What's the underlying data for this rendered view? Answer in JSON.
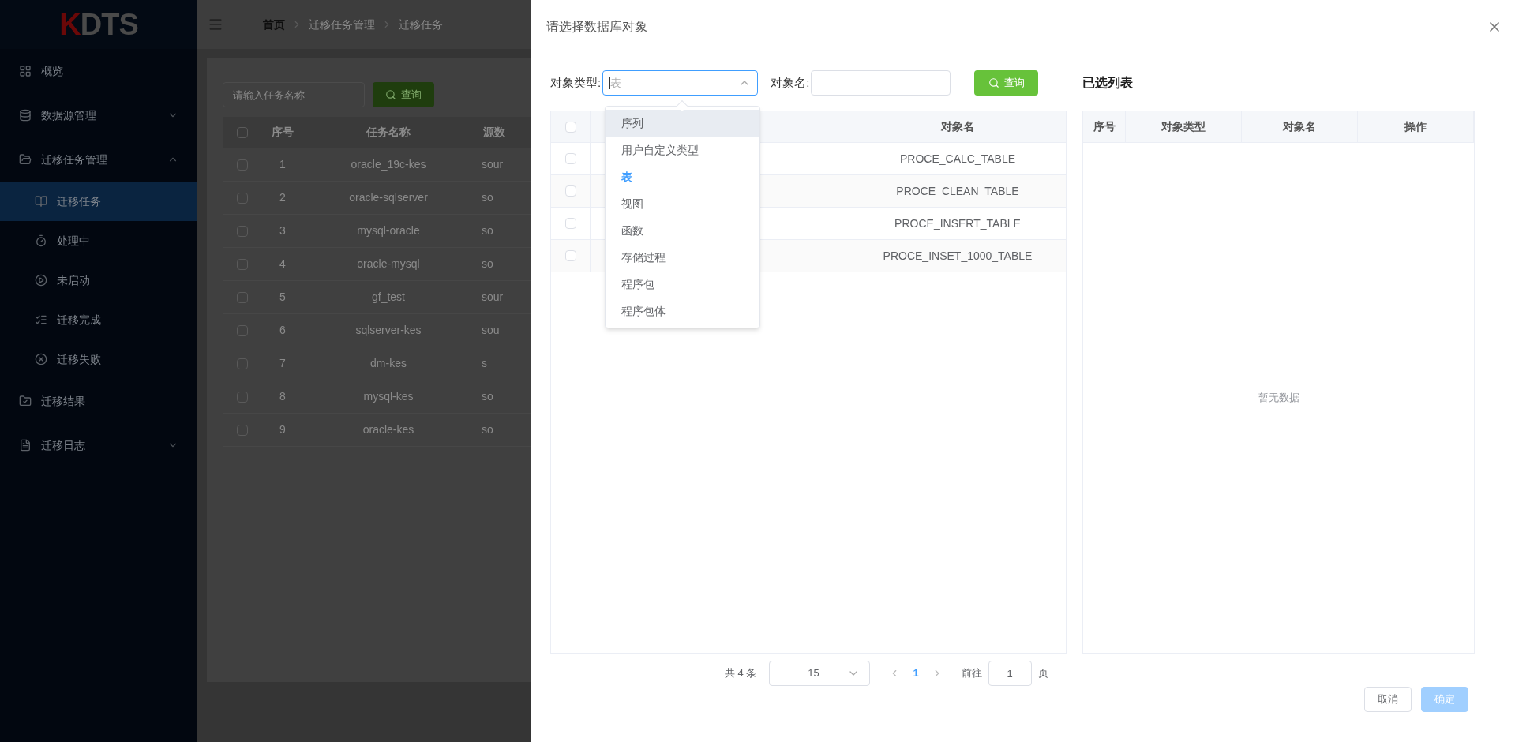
{
  "logo": {
    "text": "KDTS"
  },
  "sidebar": {
    "items": [
      {
        "label": "概览",
        "selected": false
      },
      {
        "label": "数据源管理",
        "selected": false,
        "expanded": false
      },
      {
        "label": "迁移任务管理",
        "selected": false,
        "expanded": true,
        "children": [
          {
            "label": "迁移任务",
            "selected": true
          },
          {
            "label": "处理中",
            "selected": false
          },
          {
            "label": "未启动",
            "selected": false
          },
          {
            "label": "迁移完成",
            "selected": false
          },
          {
            "label": "迁移失败",
            "selected": false
          }
        ]
      },
      {
        "label": "迁移结果",
        "selected": false
      },
      {
        "label": "迁移日志",
        "selected": false,
        "expanded": false
      }
    ]
  },
  "breadcrumb": [
    "首页",
    "迁移任务管理",
    "迁移任务"
  ],
  "task_search": {
    "placeholder": "请输入任务名称",
    "button": "查询"
  },
  "task_table": {
    "all_checked": false,
    "columns": [
      "序号",
      "任务名称",
      "源数"
    ],
    "rows": [
      {
        "checked": false,
        "cells": [
          "1",
          "oracle_19c-kes",
          "sour"
        ]
      },
      {
        "checked": false,
        "cells": [
          "2",
          "oracle-sqlserver",
          "so"
        ]
      },
      {
        "checked": false,
        "cells": [
          "3",
          "mysql-oracle",
          "so"
        ]
      },
      {
        "checked": false,
        "cells": [
          "4",
          "oracle-mysql",
          "so"
        ]
      },
      {
        "checked": false,
        "cells": [
          "5",
          "gf_test",
          "sour"
        ]
      },
      {
        "checked": false,
        "cells": [
          "6",
          "sqlserver-kes",
          "sou"
        ]
      },
      {
        "checked": false,
        "cells": [
          "7",
          "dm-kes",
          "s"
        ]
      },
      {
        "checked": false,
        "cells": [
          "8",
          "mysql-kes",
          "so"
        ]
      },
      {
        "checked": false,
        "cells": [
          "9",
          "oracle-kes",
          "so"
        ]
      }
    ]
  },
  "dialog": {
    "title": "请选择数据库对象",
    "filters": {
      "type_label": "对象类型:",
      "type_placeholder": "表",
      "name_label": "对象名:",
      "button": "查询"
    },
    "type_options": [
      {
        "label": "序列",
        "selected": false,
        "hovered": true
      },
      {
        "label": "用户自定义类型",
        "selected": false,
        "hovered": false
      },
      {
        "label": "表",
        "selected": true,
        "hovered": false
      },
      {
        "label": "视图",
        "selected": false,
        "hovered": false
      },
      {
        "label": "函数",
        "selected": false,
        "hovered": false
      },
      {
        "label": "存储过程",
        "selected": false,
        "hovered": false
      },
      {
        "label": "程序包",
        "selected": false,
        "hovered": false
      },
      {
        "label": "程序包体",
        "selected": false,
        "hovered": false
      }
    ],
    "object_table": {
      "all_checked": false,
      "columns": [
        "对象名"
      ],
      "rows": [
        {
          "checked": false,
          "name": "PROCE_CALC_TABLE"
        },
        {
          "checked": false,
          "name": "PROCE_CLEAN_TABLE"
        },
        {
          "checked": false,
          "name": "PROCE_INSERT_TABLE"
        },
        {
          "checked": false,
          "name": "PROCE_INSET_1000_TABLE"
        }
      ]
    },
    "selected_title": "已选列表",
    "selected_table": {
      "columns": [
        "序号",
        "对象类型",
        "对象名",
        "操作"
      ],
      "empty_text": "暂无数据"
    },
    "pagination": {
      "total": "共 4 条",
      "page_size": "15",
      "pages": [
        {
          "label": "1",
          "selected": true
        }
      ],
      "goto_label": "前往",
      "goto_value": "1",
      "page_unit": "页"
    },
    "buttons": [
      {
        "label": "取消",
        "kind": "default",
        "disabled": false
      },
      {
        "label": "确定",
        "kind": "primary",
        "disabled": true
      }
    ]
  }
}
